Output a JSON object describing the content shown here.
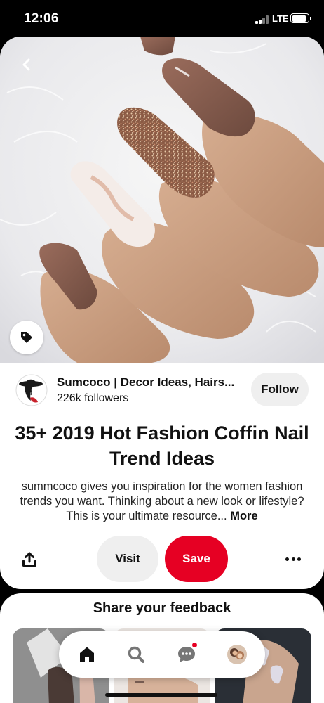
{
  "status_bar": {
    "time": "12:06",
    "network": "LTE"
  },
  "pin": {
    "image_alt": "Coffin nails in brown, glitter and marble on white fur",
    "creator": {
      "name": "Sumcoco | Decor Ideas, Hairs...",
      "followers": "226k followers",
      "follow_label": "Follow"
    },
    "title": "35+ 2019 Hot Fashion Coffin Nail Trend Ideas",
    "description": "summcoco gives you inspiration for the women fashion trends you want. Thinking about a new look or lifestyle? This is your ultimate resource...",
    "more_label": "More",
    "actions": {
      "visit_label": "Visit",
      "save_label": "Save"
    }
  },
  "feedback": {
    "title": "Share your feedback"
  },
  "bottom_nav": {
    "items": [
      {
        "name": "home",
        "icon": "home-icon",
        "active": true
      },
      {
        "name": "search",
        "icon": "search-icon",
        "active": false
      },
      {
        "name": "messages",
        "icon": "chat-icon",
        "active": false,
        "has_notification": true
      },
      {
        "name": "profile",
        "icon": "avatar",
        "active": false
      }
    ]
  },
  "colors": {
    "save_red": "#e60023",
    "button_grey": "#efefef",
    "text": "#111111"
  }
}
